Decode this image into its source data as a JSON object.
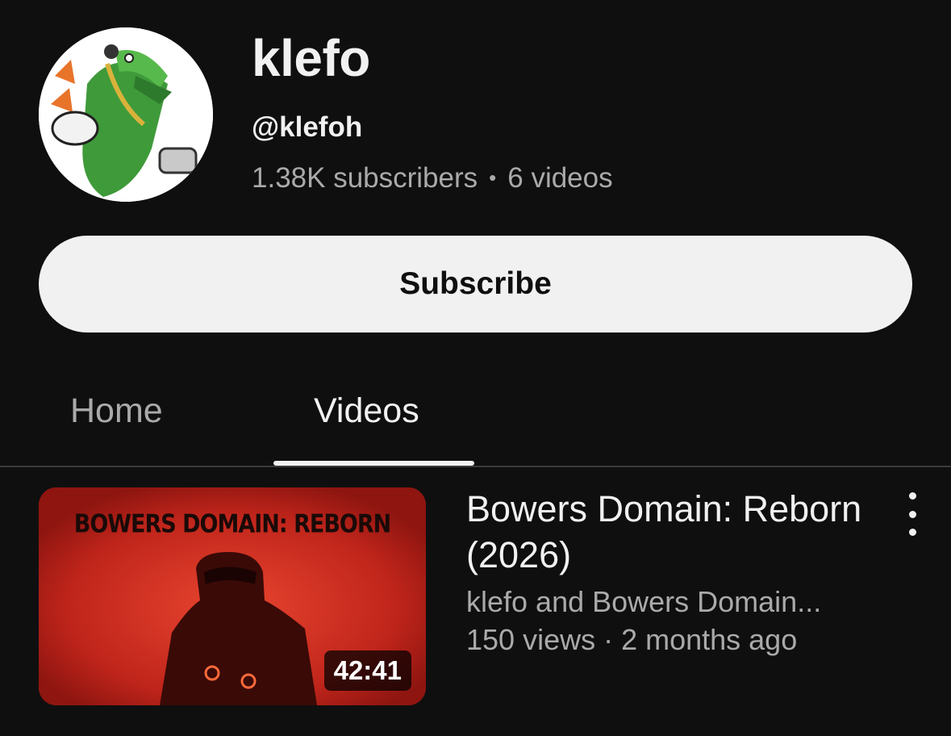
{
  "channel": {
    "name": "klefo",
    "handle": "@klefoh",
    "subscribers": "1.38K subscribers",
    "separator": "•",
    "video_count": "6 videos",
    "avatar_icon": "crocodile-character-avatar"
  },
  "subscribe_button": {
    "label": "Subscribe"
  },
  "tabs": [
    {
      "label": "Home",
      "selected": false
    },
    {
      "label": "Videos",
      "selected": true
    }
  ],
  "videos": [
    {
      "thumbnail_text": "BOWERS DOMAIN: REBORN",
      "duration": "42:41",
      "title": "Bowers Domain: Reborn (2026)",
      "author": "klefo and Bowers Domain...",
      "meta": "150 views · 2 months ago",
      "more_icon": "more-vertical-icon"
    }
  ],
  "colors": {
    "background": "#0f0f0f",
    "text_primary": "#f1f1f1",
    "text_secondary": "#aaaaaa",
    "subscribe_bg": "#f1f1f1",
    "thumbnail_red": "#c0251b"
  }
}
